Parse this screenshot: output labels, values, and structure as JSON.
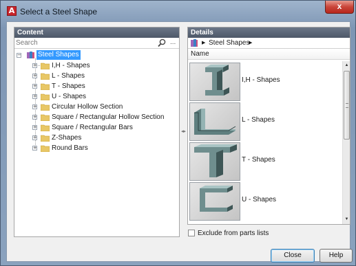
{
  "window": {
    "title": "Select a Steel Shape",
    "app_icon_glyph": "A",
    "close_glyph": "x"
  },
  "content": {
    "header": "Content",
    "search_placeholder": "Search",
    "search_more": "...",
    "tree": {
      "root": {
        "label": "Steel Shapes",
        "expander": "−"
      },
      "items": [
        {
          "label": "I,H - Shapes",
          "expander": "+"
        },
        {
          "label": "L - Shapes",
          "expander": "+"
        },
        {
          "label": "T - Shapes",
          "expander": "+"
        },
        {
          "label": "U - Shapes",
          "expander": "+"
        },
        {
          "label": "Circular Hollow Section",
          "expander": "+"
        },
        {
          "label": "Square / Rectangular Hollow Section",
          "expander": "+"
        },
        {
          "label": "Square / Rectangular Bars",
          "expander": "+"
        },
        {
          "label": "Z-Shapes",
          "expander": "+"
        },
        {
          "label": "Round Bars",
          "expander": "+"
        }
      ]
    }
  },
  "details": {
    "header": "Details",
    "breadcrumb": {
      "label": "Steel Shapes",
      "arrow": "▶"
    },
    "column_header": "Name",
    "items": [
      {
        "label": "I,H - Shapes",
        "icon": "ih-beam-icon"
      },
      {
        "label": "L - Shapes",
        "icon": "angle-icon"
      },
      {
        "label": "T - Shapes",
        "icon": "tee-icon"
      },
      {
        "label": "U - Shapes",
        "icon": "channel-icon"
      }
    ],
    "scroll_up": "▲",
    "scroll_down": "▼"
  },
  "splitter_glyph": "◂▸",
  "exclude_checkbox": {
    "label": "Exclude from parts lists",
    "checked": false
  },
  "buttons": {
    "close": "Close",
    "help": "Help"
  },
  "colors": {
    "selection": "#3399ff",
    "panel_header": "#4d5868",
    "title_close": "#c9453a"
  }
}
